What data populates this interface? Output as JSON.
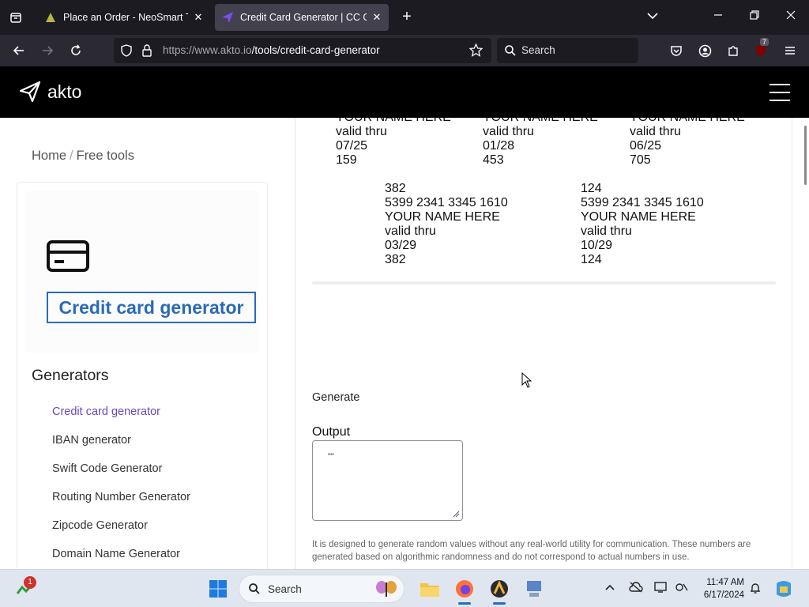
{
  "browser": {
    "tabs": [
      {
        "title": "Place an Order - NeoSmart Tech",
        "active": false
      },
      {
        "title": "Credit Card Generator | CC Gen",
        "active": true
      }
    ],
    "url": {
      "host": "https://www.akto.io",
      "path": "/tools/credit-card-generator"
    },
    "search_placeholder": "Search",
    "extension_badge": "7"
  },
  "site": {
    "logo_text": "akto"
  },
  "breadcrumb": {
    "home": "Home",
    "sep": "/",
    "current": "Free tools"
  },
  "sidebar": {
    "hero_title": "Credit card generator",
    "generators_title": "Generators",
    "items": [
      {
        "label": "Credit card generator",
        "active": true
      },
      {
        "label": "IBAN generator"
      },
      {
        "label": "Swift Code Generator"
      },
      {
        "label": "Routing Number Generator"
      },
      {
        "label": "Zipcode Generator"
      },
      {
        "label": "Domain Name Generator"
      }
    ]
  },
  "cards_top": [
    {
      "name": "YOUR NAME HERE",
      "valid": "valid thru",
      "exp": "07/25",
      "cvv": "159"
    },
    {
      "name": "YOUR NAME HERE",
      "valid": "valid thru",
      "exp": "01/28",
      "cvv": "453"
    },
    {
      "name": "YOUR NAME HERE",
      "valid": "valid thru",
      "exp": "06/25",
      "cvv": "705"
    }
  ],
  "cards_bottom": [
    {
      "cvv_top": "382",
      "number": "5399 2341 3345 1610",
      "name": "YOUR NAME HERE",
      "valid": "valid thru",
      "exp": "03/29",
      "cvv": "382"
    },
    {
      "cvv_top": "124",
      "number": "5399 2341 3345 1610",
      "name": "YOUR NAME HERE",
      "valid": "valid thru",
      "exp": "10/29",
      "cvv": "124"
    }
  ],
  "generate_label": "Generate",
  "output": {
    "label": "Output",
    "value": "\"\""
  },
  "disclaimer": "It is designed to generate random values without any real-world utility for communication. These numbers are generated based on algorithmic randomness and do not correspond to actual numbers in use.",
  "taskbar": {
    "search_label": "Search",
    "notification_badge": "1",
    "time": "11:47 AM",
    "date": "6/17/2024"
  }
}
